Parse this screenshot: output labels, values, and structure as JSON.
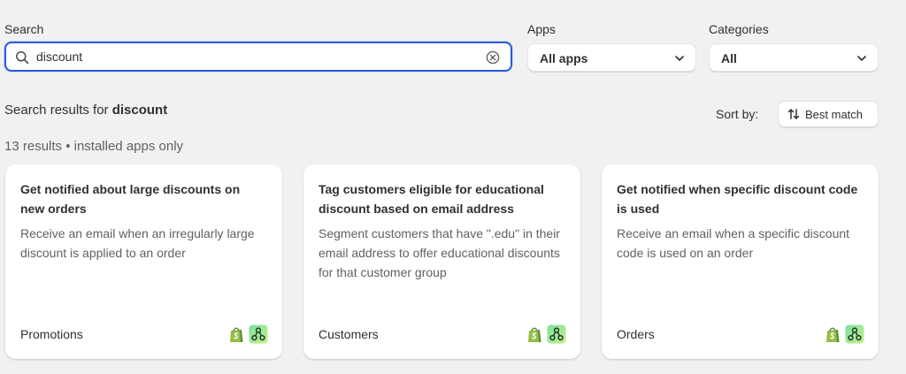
{
  "filters": {
    "search": {
      "label": "Search",
      "value": "discount",
      "placeholder": ""
    },
    "apps": {
      "label": "Apps",
      "selected": "All apps"
    },
    "categories": {
      "label": "Categories",
      "selected": "All"
    }
  },
  "results": {
    "prefix": "Search results for ",
    "query": "discount",
    "count_line": "13 results • installed apps only",
    "sort_label": "Sort by:",
    "sort_value": "Best match"
  },
  "cards": [
    {
      "title": "Get notified about large discounts on new orders",
      "description": "Receive an email when an irregularly large discount is applied to an order",
      "category": "Promotions"
    },
    {
      "title": "Tag customers eligible for educational discount based on email address",
      "description": "Segment customers that have \".edu\" in their email address to offer educational discounts for that customer group",
      "category": "Customers"
    },
    {
      "title": "Get notified when specific discount code is used",
      "description": "Receive an email when a specific discount code is used on an order",
      "category": "Orders"
    }
  ],
  "icons": {
    "search": "search-icon",
    "clear": "clear-circle-icon",
    "chevron": "chevron-down-icon",
    "sort": "sort-arrows-icon",
    "shopify": "shopify-bag-icon",
    "flow": "flow-app-icon"
  },
  "colors": {
    "focus_border": "#2a5bd7",
    "background": "#f1f1f1",
    "shopify_green": "#95bf47",
    "flow_gradient_start": "#7be0a0",
    "flow_gradient_end": "#c5f08a"
  }
}
